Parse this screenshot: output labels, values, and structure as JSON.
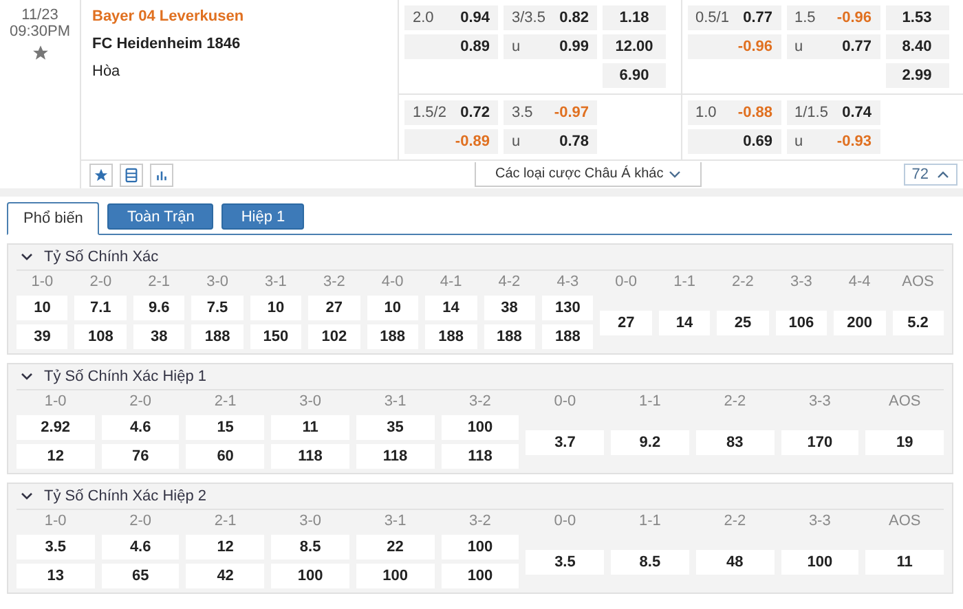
{
  "match": {
    "date": "11/23",
    "time": "09:30PM",
    "home": "Bayer 04 Leverkusen",
    "away": "FC Heidenheim 1846",
    "draw": "Hòa"
  },
  "periods": [
    {
      "blocks": [
        {
          "rows": [
            {
              "handicap": {
                "line": "2.0",
                "odds": "0.94",
                "negative": false
              },
              "over_under": {
                "line": "3/3.5",
                "odds": "0.82",
                "negative": false
              },
              "x12": "1.18"
            },
            {
              "handicap": {
                "odds": "0.89",
                "negative": false
              },
              "over_under": {
                "line": "u",
                "odds": "0.99",
                "negative": false
              },
              "x12": "12.00"
            },
            {
              "x12": "6.90"
            }
          ]
        },
        {
          "rows": [
            {
              "handicap": {
                "line": "1.5/2",
                "odds": "0.72",
                "negative": false
              },
              "over_under": {
                "line": "3.5",
                "odds": "-0.97",
                "negative": true
              }
            },
            {
              "handicap": {
                "odds": "-0.89",
                "negative": true
              },
              "over_under": {
                "line": "u",
                "odds": "0.78",
                "negative": false
              }
            }
          ]
        }
      ]
    },
    {
      "blocks": [
        {
          "rows": [
            {
              "handicap": {
                "line": "0.5/1",
                "odds": "0.77",
                "negative": false
              },
              "over_under": {
                "line": "1.5",
                "odds": "-0.96",
                "negative": true
              },
              "x12": "1.53"
            },
            {
              "handicap": {
                "odds": "-0.96",
                "negative": true
              },
              "over_under": {
                "line": "u",
                "odds": "0.77",
                "negative": false
              },
              "x12": "8.40"
            },
            {
              "x12": "2.99"
            }
          ]
        },
        {
          "rows": [
            {
              "handicap": {
                "line": "1.0",
                "odds": "-0.88",
                "negative": true
              },
              "over_under": {
                "line": "1/1.5",
                "odds": "0.74",
                "negative": false
              }
            },
            {
              "handicap": {
                "odds": "0.69",
                "negative": false
              },
              "over_under": {
                "line": "u",
                "odds": "-0.93",
                "negative": true
              }
            }
          ]
        }
      ]
    }
  ],
  "more_bets": "Các loại cược Châu Á khác",
  "more_count": "72",
  "tabs": [
    {
      "label": "Phổ biến",
      "selected": true
    },
    {
      "label": "Toàn Trận",
      "selected": false
    },
    {
      "label": "Hiệp 1",
      "selected": false
    }
  ],
  "sections": [
    {
      "title": "Tỷ Số Chính Xác",
      "expanded": true,
      "wins": [
        {
          "score": "1-0",
          "home": "10",
          "away": "39"
        },
        {
          "score": "2-0",
          "home": "7.1",
          "away": "108"
        },
        {
          "score": "2-1",
          "home": "9.6",
          "away": "38"
        },
        {
          "score": "3-0",
          "home": "7.5",
          "away": "188"
        },
        {
          "score": "3-1",
          "home": "10",
          "away": "150"
        },
        {
          "score": "3-2",
          "home": "27",
          "away": "102"
        },
        {
          "score": "4-0",
          "home": "10",
          "away": "188"
        },
        {
          "score": "4-1",
          "home": "14",
          "away": "188"
        },
        {
          "score": "4-2",
          "home": "38",
          "away": "188"
        },
        {
          "score": "4-3",
          "home": "130",
          "away": "188"
        }
      ],
      "others": [
        {
          "score": "0-0",
          "odds": "27"
        },
        {
          "score": "1-1",
          "odds": "14"
        },
        {
          "score": "2-2",
          "odds": "25"
        },
        {
          "score": "3-3",
          "odds": "106"
        },
        {
          "score": "4-4",
          "odds": "200"
        },
        {
          "score": "AOS",
          "odds": "5.2"
        }
      ]
    },
    {
      "title": "Tỷ Số Chính Xác Hiệp 1",
      "expanded": true,
      "wins": [
        {
          "score": "1-0",
          "home": "2.92",
          "away": "12"
        },
        {
          "score": "2-0",
          "home": "4.6",
          "away": "76"
        },
        {
          "score": "2-1",
          "home": "15",
          "away": "60"
        },
        {
          "score": "3-0",
          "home": "11",
          "away": "118"
        },
        {
          "score": "3-1",
          "home": "35",
          "away": "118"
        },
        {
          "score": "3-2",
          "home": "100",
          "away": "118"
        }
      ],
      "others": [
        {
          "score": "0-0",
          "odds": "3.7"
        },
        {
          "score": "1-1",
          "odds": "9.2"
        },
        {
          "score": "2-2",
          "odds": "83"
        },
        {
          "score": "3-3",
          "odds": "170"
        },
        {
          "score": "AOS",
          "odds": "19"
        }
      ]
    },
    {
      "title": "Tỷ Số Chính Xác Hiệp 2",
      "expanded": true,
      "wins": [
        {
          "score": "1-0",
          "home": "3.5",
          "away": "13"
        },
        {
          "score": "2-0",
          "home": "4.6",
          "away": "65"
        },
        {
          "score": "2-1",
          "home": "12",
          "away": "42"
        },
        {
          "score": "3-0",
          "home": "8.5",
          "away": "100"
        },
        {
          "score": "3-1",
          "home": "22",
          "away": "100"
        },
        {
          "score": "3-2",
          "home": "100",
          "away": "100"
        }
      ],
      "others": [
        {
          "score": "0-0",
          "odds": "3.5"
        },
        {
          "score": "1-1",
          "odds": "8.5"
        },
        {
          "score": "2-2",
          "odds": "48"
        },
        {
          "score": "3-3",
          "odds": "100"
        },
        {
          "score": "AOS",
          "odds": "11"
        }
      ]
    }
  ]
}
